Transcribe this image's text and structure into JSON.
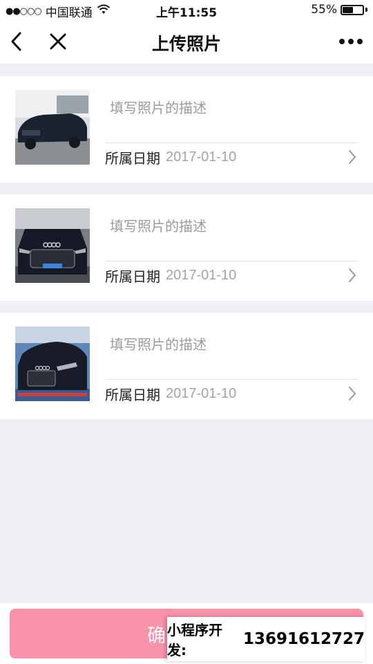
{
  "status_bar": {
    "signal": "●●○○○",
    "carrier": "中国联通",
    "time": "上午11:55",
    "battery_text": "55%",
    "battery_level": 0.55
  },
  "nav": {
    "title": "上传照片",
    "back_icon": "chevron-left-icon",
    "close_icon": "close-icon",
    "more_icon": "more-dots-icon"
  },
  "photos": [
    {
      "description_placeholder": "填写照片的描述",
      "description_value": "",
      "date_label": "所属日期",
      "date_value": "2017-01-10"
    },
    {
      "description_placeholder": "填写照片的描述",
      "description_value": "",
      "date_label": "所属日期",
      "date_value": "2017-01-10"
    },
    {
      "description_placeholder": "填写照片的描述",
      "description_value": "",
      "date_label": "所属日期",
      "date_value": "2017-01-10"
    }
  ],
  "confirm_button": {
    "label": "确"
  },
  "promo": {
    "label": "小程序开发:",
    "phone": "13691612727"
  },
  "colors": {
    "confirm": "#f992ab",
    "page_bg": "#efeff4"
  }
}
